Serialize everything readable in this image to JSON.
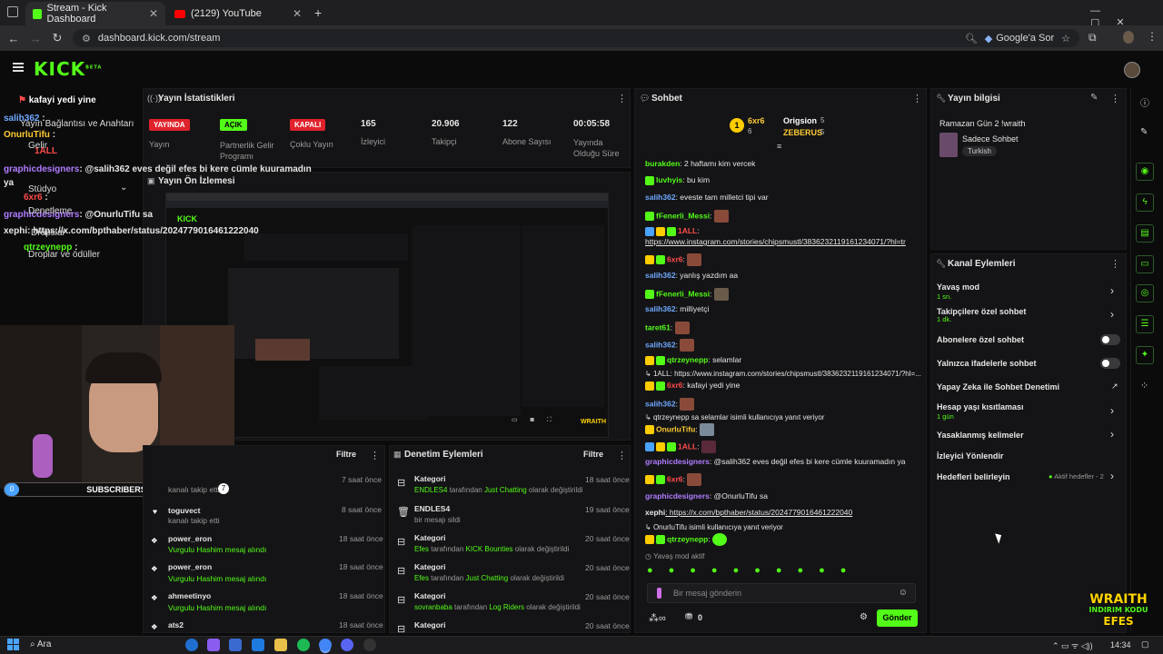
{
  "browser": {
    "tabs": [
      {
        "label": "Stream - Kick Dashboard",
        "active": true
      },
      {
        "label": "(2129) YouTube",
        "active": false
      }
    ],
    "url": "dashboard.kick.com/stream",
    "google_btn": "Google'a Sor"
  },
  "kick": {
    "logo": "KICK",
    "logo_sup": "BETA"
  },
  "overlay_chat": [
    {
      "user": "",
      "text": "kafayi yedi yine"
    },
    {
      "user": "salih362",
      "text": ":"
    },
    {
      "user": "OnurluTifu",
      "text": ":"
    },
    {
      "user": "1ALL",
      "text": ""
    },
    {
      "user": "graphicdesigners",
      "text": ": @salih362 eves değil efes bi kere cümle kuuramadın ya"
    },
    {
      "user": "6xr6",
      "text": ":"
    },
    {
      "user": "graphicdesigners",
      "text": ": @OnurluTifu sa"
    },
    {
      "user": "xephi",
      "text": ": https://x.com/bpthaber/status/2024779016461222040"
    },
    {
      "user": "qtrzeynepp",
      "text": ":"
    }
  ],
  "sidebar_menu": [
    "Yayın Bağlantısı ve Anahtarı",
    "Gelir",
    "Stüdyo",
    "Denetleme",
    "Dropslar",
    "Droplar ve ödüller"
  ],
  "stats": {
    "title": "Yayın İstatistikleri",
    "items": [
      {
        "badge": "YAYINDA",
        "badge_color": "#e0222b",
        "label": "Yayın"
      },
      {
        "badge": "AÇIK",
        "badge_color": "#53fc18",
        "label": "Partnerlik Gelir Programı"
      },
      {
        "badge": "KAPALI",
        "badge_color": "#e0222b",
        "label": "Çoklu Yayın"
      },
      {
        "value": "165",
        "label": "İzleyici"
      },
      {
        "value": "20.906",
        "label": "Takipçi"
      },
      {
        "value": "122",
        "label": "Abone Sayısı"
      },
      {
        "value": "00:05:58",
        "label": "Yayında Olduğu Süre"
      }
    ]
  },
  "preview": {
    "title": "Yayın Ön İzlemesi"
  },
  "webcam": {
    "subscribers_label": "SUBSCRIBERS",
    "subscribers_count": "0"
  },
  "activity": {
    "filter": "Filtre",
    "items": [
      {
        "user": "",
        "text": "kanalı takip etti",
        "time": "7 saat önce",
        "count": "7"
      },
      {
        "user": "toguvect",
        "text": "kanalı takip etti",
        "time": "8 saat önce"
      },
      {
        "user": "power_eron",
        "text": "Vurgulu Hashim mesaj alındı",
        "time": "18 saat önce"
      },
      {
        "user": "power_eron",
        "text": "Vurgulu Hashim mesaj alındı",
        "time": "18 saat önce"
      },
      {
        "user": "ahmeetinyo",
        "text": "Vurgulu Hashim mesaj alındı",
        "time": "18 saat önce"
      },
      {
        "user": "ats2",
        "text": "",
        "time": "18 saat önce"
      }
    ]
  },
  "moderation": {
    "title": "Denetim Eylemleri",
    "filter": "Filtre",
    "items": [
      {
        "title": "Kategori",
        "user": "ENDLES4",
        "mid": "tarafından",
        "target": "Just Chatting",
        "tail": "olarak değiştirildi",
        "time": "18 saat önce"
      },
      {
        "title": "ENDLES4",
        "user": "",
        "mid": "bir mesajı sildi",
        "target": "",
        "tail": "",
        "time": "19 saat önce"
      },
      {
        "title": "Kategori",
        "user": "Efes",
        "mid": "tarafından",
        "target": "KICK Bounties",
        "tail": "olarak değiştirildi",
        "time": "20 saat önce"
      },
      {
        "title": "Kategori",
        "user": "Efes",
        "mid": "tarafından",
        "target": "Just Chatting",
        "tail": "olarak değiştirildi",
        "time": "20 saat önce"
      },
      {
        "title": "Kategori",
        "user": "sovranbaba",
        "mid": "tarafından",
        "target": "Log Riders",
        "tail": "olarak değiştirildi",
        "time": "20 saat önce"
      },
      {
        "title": "Kategori",
        "user": "",
        "mid": "",
        "target": "",
        "tail": "",
        "time": "20 saat önce"
      }
    ]
  },
  "chat": {
    "title": "Sohbet",
    "leaders": [
      {
        "name": "6xr6",
        "score": "6"
      },
      {
        "name": "Origsion",
        "score": "5"
      },
      {
        "name": "ZEBERUS",
        "score": "5"
      }
    ],
    "lines": [
      {
        "user": "burakden",
        "color": "#53fc18",
        "text": ": 2 haftamı kim vercek"
      },
      {
        "user": "luvhyis",
        "color": "#53fc18",
        "text": ": bu kim"
      },
      {
        "user": "salih362",
        "color": "#6fa8ff",
        "text": ": eveste tam milletci tipi var"
      },
      {
        "user": "fFenerli_Messi",
        "color": "#53fc18",
        "text": ":"
      },
      {
        "user": "1ALL",
        "color": "#ff4b4b",
        "text": ":"
      },
      {
        "user": "",
        "color": "#6fa8ff",
        "text": "https://www.instagram.com/stories/chipsmustl/3836232119161234071/?hl=tr"
      },
      {
        "user": "6xr6",
        "color": "#ff4b4b",
        "text": ":"
      },
      {
        "user": "salih362",
        "color": "#6fa8ff",
        "text": ": yanlış yazdım aa"
      },
      {
        "user": "fFenerli_Messi",
        "color": "#53fc18",
        "text": ":"
      },
      {
        "user": "salih362",
        "color": "#6fa8ff",
        "text": ": milliyetçi"
      },
      {
        "user": "taret61",
        "color": "#53fc18",
        "text": ":"
      },
      {
        "user": "salih362",
        "color": "#6fa8ff",
        "text": ":"
      },
      {
        "user": "qtrzeynepp",
        "color": "#53fc18",
        "text": ": selamlar"
      },
      {
        "user": "1ALL",
        "color": "#9a9a9a",
        "text": ": https://www.instagram.com/stories/chipsmustl/3836232119161234071/?hl=..."
      },
      {
        "user": "6xr6",
        "color": "#ff4b4b",
        "text": ": kafayi yedi yine"
      },
      {
        "user": "salih362",
        "color": "#6fa8ff",
        "text": ":"
      },
      {
        "user": "qtrzeynepp",
        "color": "#9a9a9a",
        "text": " sa selamlar isimli kullanıcıya yanıt veriyor"
      },
      {
        "user": "OnurluTifu",
        "color": "#ffcc33",
        "text": ":"
      },
      {
        "user": "1ALL",
        "color": "#ff4b4b",
        "text": ":"
      },
      {
        "user": "graphicdesigners",
        "color": "#b07cff",
        "text": ": @salih362 eves değil efes bi kere cümle kuuramadın ya"
      },
      {
        "user": "6xr6",
        "color": "#ff4b4b",
        "text": ":"
      },
      {
        "user": "graphicdesigners",
        "color": "#b07cff",
        "text": ": @OnurluTifu sa"
      },
      {
        "user": "xephi",
        "color": "#e6e6e6",
        "text": ": https://x.com/bpthaber/status/2024779016461222040"
      },
      {
        "user": "OnurluTifu",
        "color": "#9a9a9a",
        "text": " isimli kullanıcıya yanıt veriyor"
      },
      {
        "user": "qtrzeynepp",
        "color": "#53fc18",
        "text": ":"
      }
    ],
    "slow_mode_note": "Yavaş mod aktif",
    "input_placeholder": "Bir mesaj gönderin",
    "points": "0",
    "send_label": "Gönder"
  },
  "stream_info": {
    "title": "Yayın bilgisi",
    "stream_title": "Ramazan Gün 2 !wraith",
    "category": "Sadece Sohbet",
    "tag": "Turkish"
  },
  "channel_actions": {
    "title": "Kanal Eylemleri",
    "items": [
      {
        "label": "Yavaş mod",
        "sub": "1 sn.",
        "control": "chevron"
      },
      {
        "label": "Takipçilere özel sohbet",
        "sub": "1 dk.",
        "control": "chevron"
      },
      {
        "label": "Abonelere özel sohbet",
        "sub": "",
        "control": "toggle"
      },
      {
        "label": "Yalnızca ifadelerle sohbet",
        "sub": "",
        "control": "toggle"
      },
      {
        "label": "Yapay Zeka ile Sohbet Denetimi",
        "sub": "",
        "control": "external"
      },
      {
        "label": "Hesap yaşı kısıtlaması",
        "sub": "1 gün",
        "control": "chevron"
      },
      {
        "label": "Yasaklanmış kelimeler",
        "sub": "",
        "control": "chevron"
      },
      {
        "label": "İzleyici Yönlendir",
        "sub": "",
        "control": "none"
      },
      {
        "label": "Hedefleri belirleyin",
        "sub": "",
        "control": "chevron",
        "status": "Aktif hedefler - 2"
      }
    ]
  },
  "watermark": {
    "line1": "WRAITH",
    "line2": "INDIRIM KODU",
    "line3": "EFES"
  },
  "taskbar": {
    "search": "Ara",
    "time": "14:34"
  },
  "colors": {
    "accent": "#53fc18",
    "live": "#e0222b",
    "bg": "#0b0b0c",
    "panel": "#141416"
  }
}
